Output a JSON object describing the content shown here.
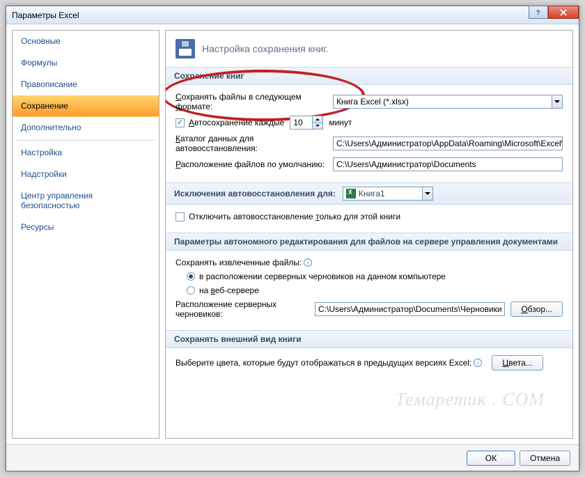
{
  "window": {
    "title": "Параметры Excel"
  },
  "sidebar": {
    "items": [
      {
        "label": "Основные"
      },
      {
        "label": "Формулы"
      },
      {
        "label": "Правописание"
      },
      {
        "label": "Сохранение"
      },
      {
        "label": "Дополнительно"
      },
      {
        "label": "Настройка"
      },
      {
        "label": "Надстройки"
      },
      {
        "label": "Центр управления безопасностью"
      },
      {
        "label": "Ресурсы"
      }
    ]
  },
  "header": {
    "title": "Настройка сохранения книг."
  },
  "sections": {
    "save_books": {
      "title": "Сохранение книг",
      "format_label": "Сохранять файлы в следующем формате:",
      "format_value": "Книга Excel (*.xlsx)",
      "autosave_label": "Автосохранение каждые",
      "autosave_value": "10",
      "autosave_unit": "минут",
      "recovery_path_label": "Каталог данных для автовосстановления:",
      "recovery_path_value": "C:\\Users\\Администратор\\AppData\\Roaming\\Microsoft\\Excel\\",
      "default_path_label": "Расположение файлов по умолчанию:",
      "default_path_value": "C:\\Users\\Администратор\\Documents"
    },
    "exceptions": {
      "title": "Исключения автовосстановления для:",
      "book_value": "Книга1",
      "disable_label": "Отключить автовосстановление только для этой книги"
    },
    "offline": {
      "title": "Параметры автономного редактирования для файлов на сервере управления документами",
      "save_extracted": "Сохранять извлеченные файлы:",
      "opt1": "в расположении серверных черновиков на данном компьютере",
      "opt2": "на веб-сервере",
      "drafts_label": "Расположение серверных черновиков:",
      "drafts_value": "C:\\Users\\Администратор\\Documents\\Черновики",
      "browse": "Обзор..."
    },
    "appearance": {
      "title": "Сохранять внешний вид книги",
      "text": "Выберите цвета, которые будут отображаться в предыдущих версиях Excel:",
      "colors_btn": "Цвета..."
    }
  },
  "footer": {
    "ok": "ОК",
    "cancel": "Отмена"
  },
  "watermark": "Темаретик . COM"
}
